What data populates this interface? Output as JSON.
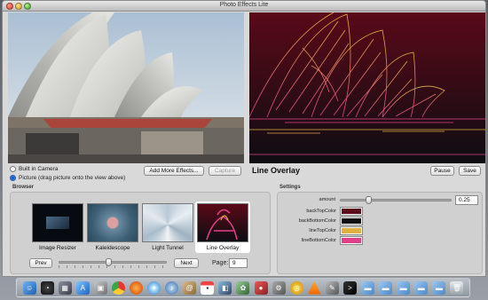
{
  "window": {
    "title": "Photo Effects Lite"
  },
  "source": {
    "options": [
      {
        "label": "Built in Camera",
        "selected": false
      },
      {
        "label": "Picture (drag picture onto the view above)",
        "selected": true
      }
    ]
  },
  "buttons": {
    "add_more_effects": "Add More Effects...",
    "capture": "Capture",
    "pause": "Pause",
    "save": "Save",
    "prev": "Prev",
    "next": "Next"
  },
  "effect": {
    "name": "Line Overlay"
  },
  "browser": {
    "title": "Browser",
    "items": [
      {
        "label": "Image Resizer",
        "selected": false
      },
      {
        "label": "Kaleidescope",
        "selected": false
      },
      {
        "label": "Light Tunnel",
        "selected": false
      },
      {
        "label": "Line Overlay",
        "selected": true
      }
    ],
    "page_label": "Page:",
    "page_value": "9",
    "slider_position": 0.46
  },
  "settings": {
    "title": "Settings",
    "amount_label": "amount",
    "amount_value": "0.25",
    "amount_position": 0.25,
    "colors": [
      {
        "label": "backTopColor",
        "color": "#5a0a18"
      },
      {
        "label": "backBottomColor",
        "color": "#0d0d12"
      },
      {
        "label": "lineTopColor",
        "color": "#e0b040"
      },
      {
        "label": "lineBottomColor",
        "color": "#e0408a"
      }
    ]
  },
  "dock": {
    "icons": [
      "finder-icon",
      "dashboard-icon",
      "mission-control-icon",
      "app-store-icon",
      "photo-icon",
      "chrome-icon",
      "firefox-icon",
      "safari-icon",
      "itunes-icon",
      "address-book-icon",
      "calendar-icon",
      "preview-icon",
      "iphoto-icon",
      "photo-booth-icon",
      "system-preferences-icon",
      "photo-effects-icon",
      "vlc-icon",
      "utility-icon",
      "terminal-icon",
      "folder-icon",
      "folder-icon",
      "folder-icon",
      "folder-icon",
      "folder-icon",
      "trash-icon"
    ]
  }
}
